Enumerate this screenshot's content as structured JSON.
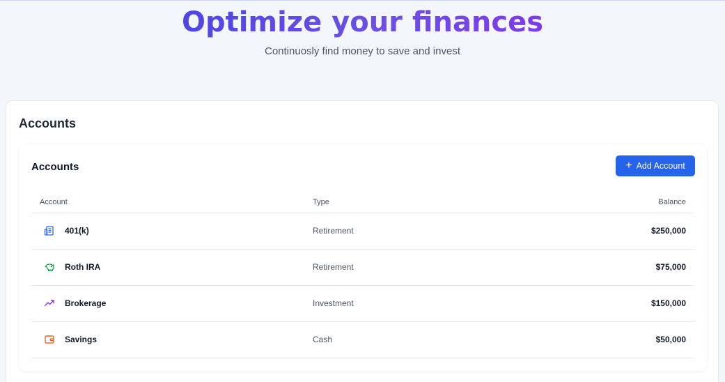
{
  "hero": {
    "title": "Optimize your finances",
    "subtitle": "Continuosly find money to save and invest"
  },
  "section": {
    "title": "Accounts"
  },
  "accounts_card": {
    "title": "Accounts",
    "add_button_label": "Add Account",
    "columns": [
      "Account",
      "Type",
      "Balance"
    ],
    "rows": [
      {
        "name": "401(k)",
        "type": "Retirement",
        "balance": "$250,000",
        "icon": "building-icon",
        "icon_color": "#2563eb"
      },
      {
        "name": "Roth IRA",
        "type": "Retirement",
        "balance": "$75,000",
        "icon": "piggy-bank-icon",
        "icon_color": "#16a34a"
      },
      {
        "name": "Brokerage",
        "type": "Investment",
        "balance": "$150,000",
        "icon": "trending-up-icon",
        "icon_color": "#9333ea"
      },
      {
        "name": "Savings",
        "type": "Cash",
        "balance": "$50,000",
        "icon": "wallet-icon",
        "icon_color": "#ea580c"
      }
    ]
  },
  "colors": {
    "accent": "#2563eb",
    "title_gradient_start": "#4f46e5",
    "title_gradient_end": "#7c3aed"
  }
}
